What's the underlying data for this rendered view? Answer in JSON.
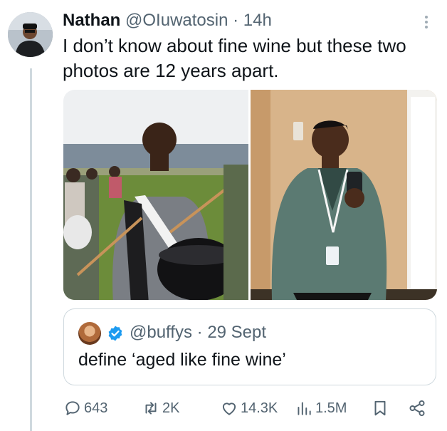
{
  "author": {
    "name": "Nathan",
    "handle": "@OIuwatosin",
    "separator": "·",
    "time": "14h"
  },
  "tweet": {
    "text": "I don’t know about fine wine but these two photos are 12 years apart."
  },
  "quote": {
    "handle": "@buffys",
    "separator": "·",
    "date": "29 Sept",
    "text": "define ‘aged like fine wine’"
  },
  "actions": {
    "replies": "643",
    "retweets": "2K",
    "likes": "14.3K",
    "views": "1.5M"
  },
  "colors": {
    "text": "#0f1419",
    "secondary": "#536471",
    "border": "#cfd9de",
    "verified": "#1d9bf0"
  }
}
